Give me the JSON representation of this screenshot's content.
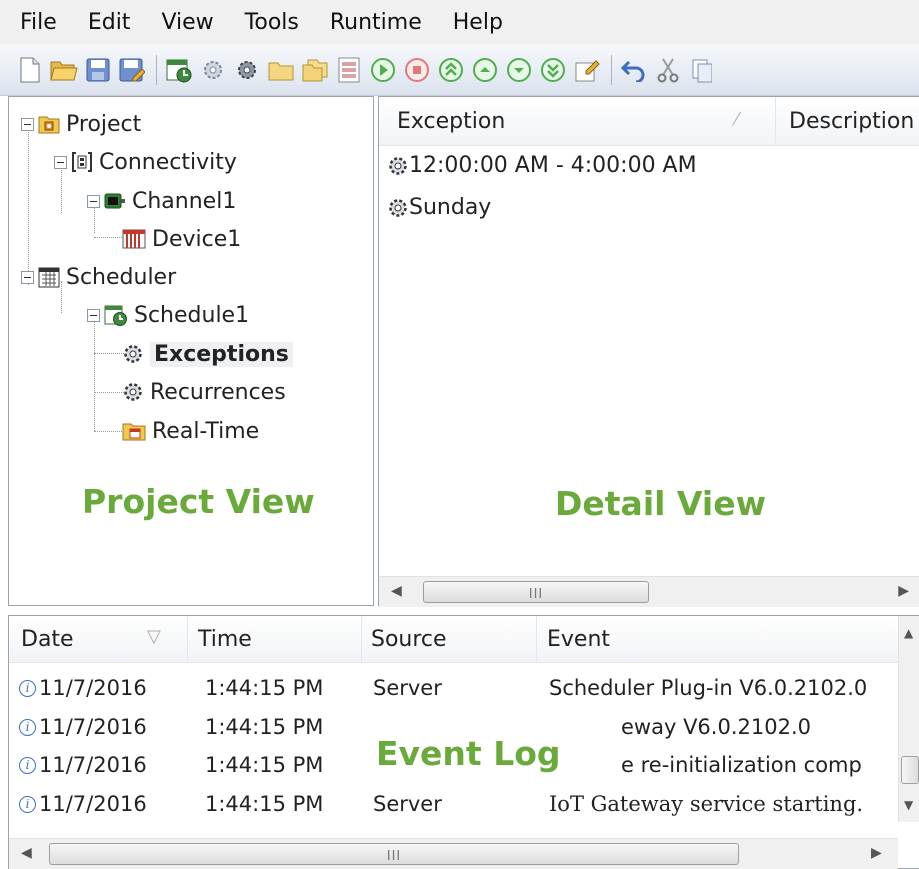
{
  "menu": [
    "File",
    "Edit",
    "View",
    "Tools",
    "Runtime",
    "Help"
  ],
  "toolbar_icons": [
    "new-project-icon",
    "open-icon",
    "save-icon",
    "save-as-icon",
    "new-schedule-icon",
    "new-exception-icon",
    "new-recurrence-icon",
    "new-folder-icon",
    "duplicate-icon",
    "properties-icon",
    "play-icon",
    "stop-icon",
    "move-top-icon",
    "move-up-icon",
    "move-down-icon",
    "move-bottom-icon",
    "edit-icon",
    "undo-icon",
    "cut-icon",
    "copy-icon"
  ],
  "tree": {
    "project": "Project",
    "connectivity": "Connectivity",
    "channel": "Channel1",
    "device": "Device1",
    "scheduler": "Scheduler",
    "schedule": "Schedule1",
    "exceptions": "Exceptions",
    "recurrences": "Recurrences",
    "realtime": "Real-Time"
  },
  "labels": {
    "project_view": "Project View",
    "detail_view": "Detail View",
    "event_log": "Event Log"
  },
  "detail": {
    "columns": [
      "Exception",
      "Description"
    ],
    "items": [
      "12:00:00 AM - 4:00:00 AM",
      "Sunday"
    ]
  },
  "event_log": {
    "columns": [
      "Date",
      "Time",
      "Source",
      "Event"
    ],
    "rows": [
      {
        "date": "11/7/2016",
        "time": "1:44:15 PM",
        "source": "Server",
        "event": "Scheduler Plug-in V6.0.2102.0"
      },
      {
        "date": "11/7/2016",
        "time": "1:44:15 PM",
        "source": "",
        "event": "eway V6.0.2102.0"
      },
      {
        "date": "11/7/2016",
        "time": "1:44:15 PM",
        "source": "",
        "event": "e re-initialization comp"
      },
      {
        "date": "11/7/2016",
        "time": "1:44:15 PM",
        "source": "Server",
        "event": "IoT Gateway service starting."
      }
    ]
  },
  "scroll_grip": "III",
  "colors": {
    "accent_green": "#6aaa3a",
    "info_blue": "#3a6fc4",
    "toolbar_top": "#f6f8fb"
  }
}
